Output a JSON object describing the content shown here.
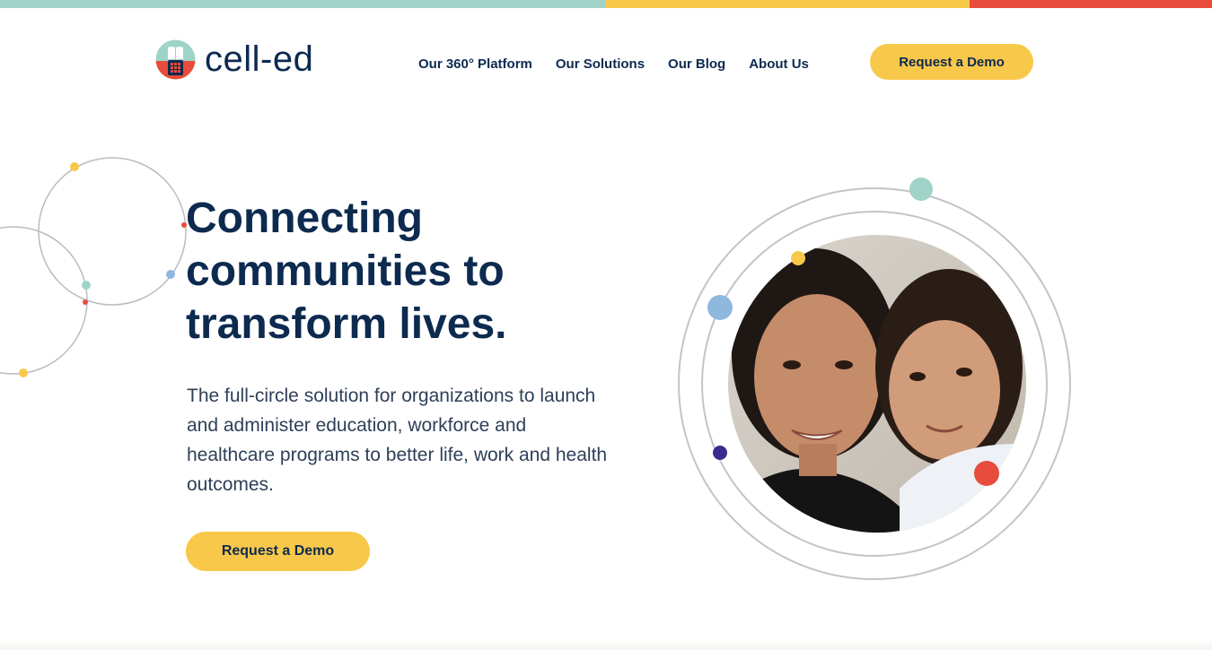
{
  "brand": {
    "name": "cell-ed",
    "colors": {
      "navy": "#0d2a4f",
      "yellow": "#f8c84a",
      "teal": "#9fd3c7",
      "red": "#e74c3c",
      "blue": "#8fb8df",
      "purple": "#3d2a8f"
    }
  },
  "nav": {
    "items": [
      {
        "label": "Our 360° Platform"
      },
      {
        "label": "Our Solutions"
      },
      {
        "label": "Our Blog"
      },
      {
        "label": "About Us"
      }
    ],
    "cta_label": "Request a Demo"
  },
  "hero": {
    "title": "Connecting communities to transform lives.",
    "subtitle": "The full-circle solution for organizations to launch and administer education, workforce and healthcare programs to better life, work and health outcomes.",
    "cta_label": "Request a Demo",
    "photo_icon": "mother-and-daughter-photo"
  }
}
